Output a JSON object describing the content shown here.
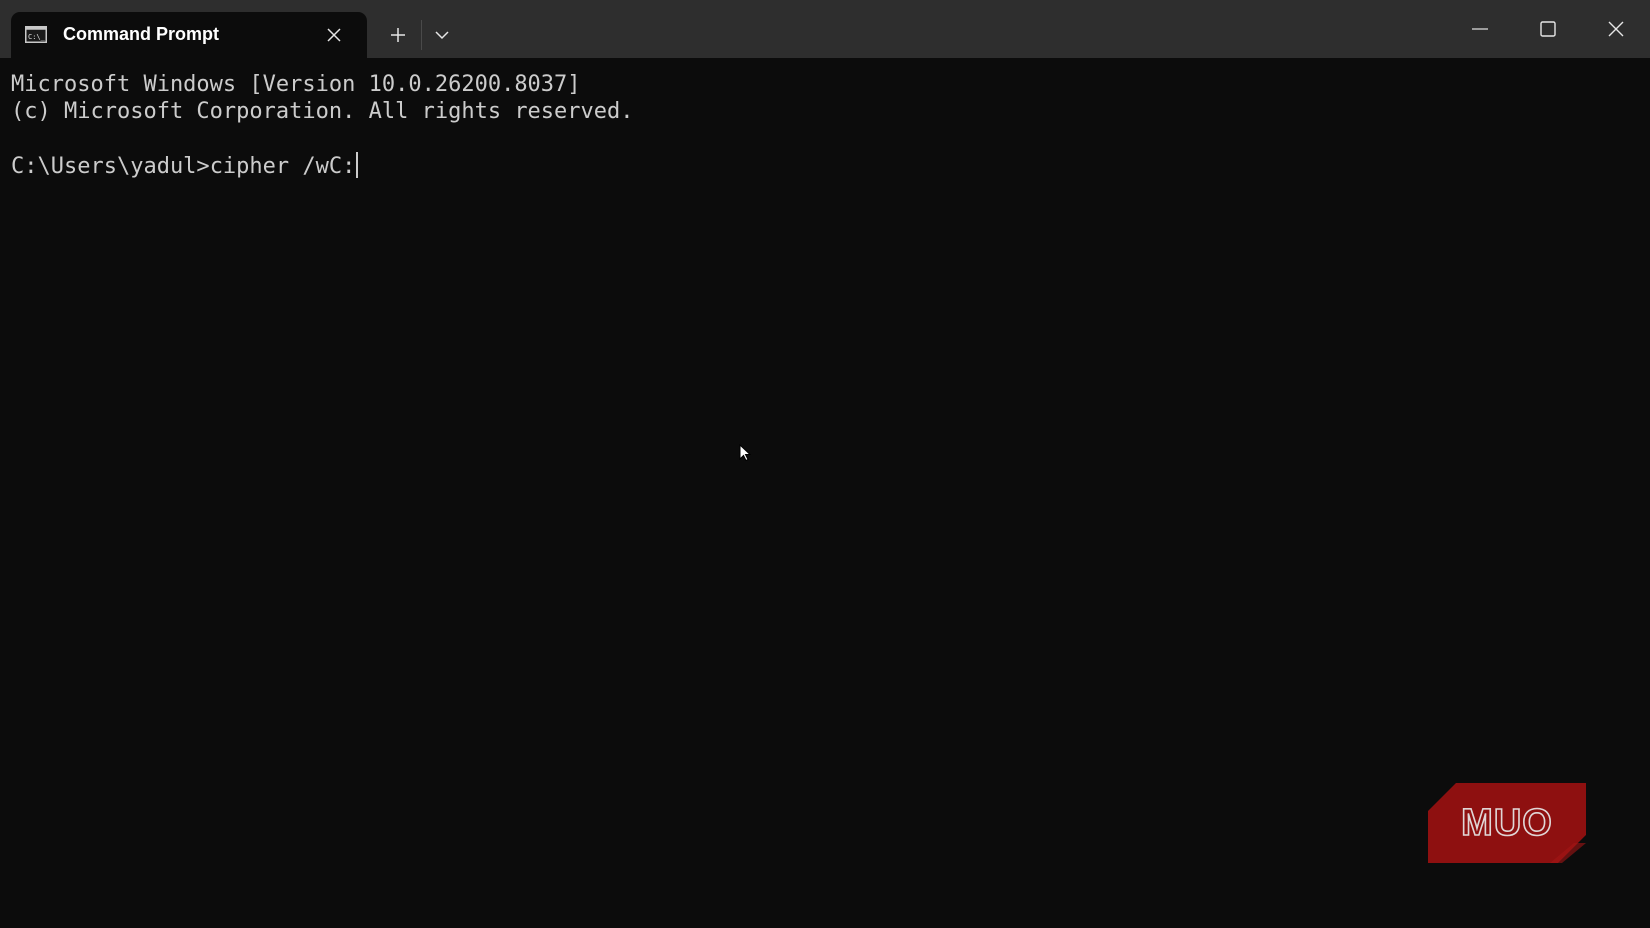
{
  "window": {
    "tab_title": "Command Prompt",
    "tab_icon": "command-prompt-icon",
    "controls": [
      "minimize-icon",
      "maximize-icon",
      "close-icon"
    ]
  },
  "terminal": {
    "lines": [
      "Microsoft Windows [Version 10.0.26200.8037]",
      "(c) Microsoft Corporation. All rights reserved."
    ],
    "prompt": "C:\\Users\\yadul>",
    "command": "cipher /wC:"
  },
  "watermark": {
    "logo": "muo-logo",
    "text": "MUO"
  },
  "colors": {
    "titlebar": "#2e2e2e",
    "background": "#0c0c0c",
    "text": "#cccccc",
    "watermark_red": "#8e1010"
  }
}
